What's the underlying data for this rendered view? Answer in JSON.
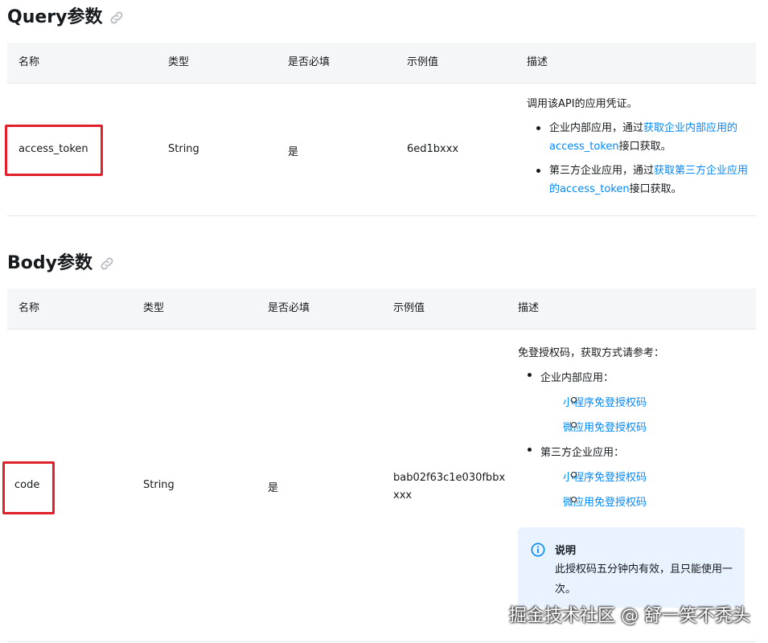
{
  "query": {
    "title": "Query参数",
    "headers": {
      "name": "名称",
      "type": "类型",
      "required": "是否必填",
      "example": "示例值",
      "desc": "描述"
    },
    "row": {
      "name": "access_token",
      "type": "String",
      "required": "是",
      "example": "6ed1bxxx",
      "desc_intro": "调用该API的应用凭证。",
      "bullet1_prefix": "企业内部应用，通过",
      "bullet1_link": "获取企业内部应用的access_token",
      "bullet1_suffix": "接口获取。",
      "bullet2_prefix": "第三方企业应用，通过",
      "bullet2_link": "获取第三方企业应用的access_token",
      "bullet2_suffix": "接口获取。"
    }
  },
  "body": {
    "title": "Body参数",
    "headers": {
      "name": "名称",
      "type": "类型",
      "required": "是否必填",
      "example": "示例值",
      "desc": "描述"
    },
    "row": {
      "name": "code",
      "type": "String",
      "required": "是",
      "example": "bab02f63c1e030fbbxxxx",
      "desc_intro": "免登授权码，获取方式请参考：",
      "group1_label": "企业内部应用：",
      "group1_links": [
        "小程序免登授权码",
        "微应用免登授权码"
      ],
      "group2_label": "第三方企业应用：",
      "group2_links": [
        "小程序免登授权码",
        "微应用免登授权码"
      ],
      "note_title": "说明",
      "note_text": "此授权码五分钟内有效，且只能使用一次。"
    }
  },
  "watermark": "掘金技术社区 @ 舒一笑不秃头",
  "colors": {
    "link": "#0089ff",
    "highlight_box": "#e0202a",
    "note_bg": "#e8f3ff",
    "header_bg": "#f5f6f7"
  },
  "icons": {
    "link": "link-icon",
    "info": "info-icon"
  }
}
